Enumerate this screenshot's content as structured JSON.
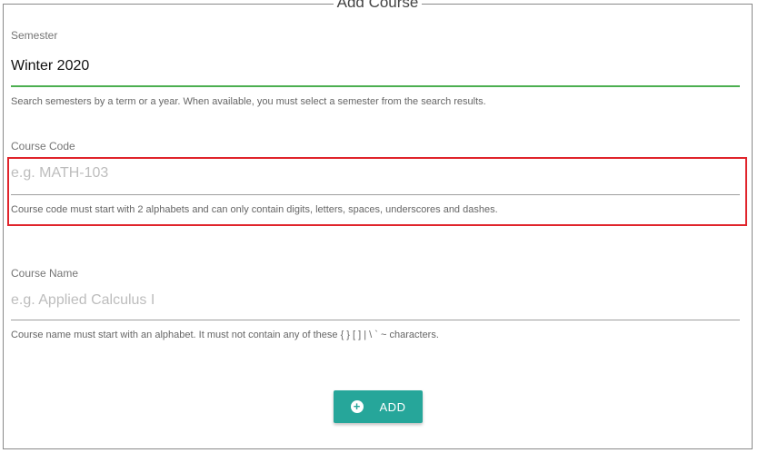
{
  "dialog": {
    "title": "Add Course"
  },
  "semester": {
    "label": "Semester",
    "value": "Winter 2020",
    "hint": "Search semesters by a term or a year. When available, you must select a semester from the search results."
  },
  "course_code": {
    "label": "Course Code",
    "placeholder": "e.g. MATH-103",
    "hint": "Course code must start with 2 alphabets and can only contain digits, letters, spaces, underscores and dashes."
  },
  "course_name": {
    "label": "Course Name",
    "placeholder": "e.g. Applied Calculus I",
    "hint": "Course name must start with an alphabet. It must not contain any of these { } [ ] | \\ ` ~ characters."
  },
  "actions": {
    "add_label": "ADD",
    "add_icon": "plus-circle-icon"
  },
  "colors": {
    "accent": "#26a69a",
    "focus_underline": "#4caf50",
    "highlight": "#e0242b"
  }
}
